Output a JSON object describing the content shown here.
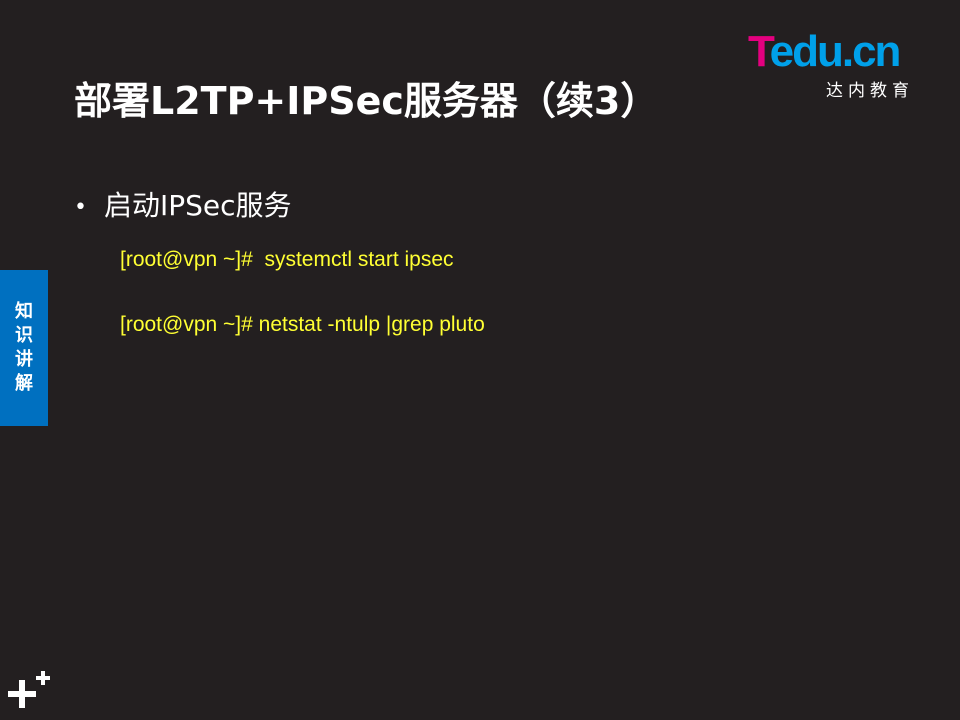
{
  "slide": {
    "title": "部署L2TP+IPSec服务器（续3）",
    "bullet": "启动IPSec服务",
    "code_lines": [
      "[root@vpn ~]#  systemctl start ipsec",
      "[root@vpn ~]# netstat -ntulp |grep pluto"
    ]
  },
  "logo": {
    "t": "T",
    "rest": "edu.cn",
    "subtitle": "达内教育"
  },
  "side_tab": {
    "chars": [
      "知",
      "识",
      "讲",
      "解"
    ]
  },
  "colors": {
    "background": "#231f20",
    "title": "#ffffff",
    "code": "#ffff33",
    "side_tab": "#0070c0",
    "logo_pink": "#e4007f",
    "logo_blue": "#00a0e9"
  },
  "icons": {
    "bottom_left": "plus-icon"
  }
}
